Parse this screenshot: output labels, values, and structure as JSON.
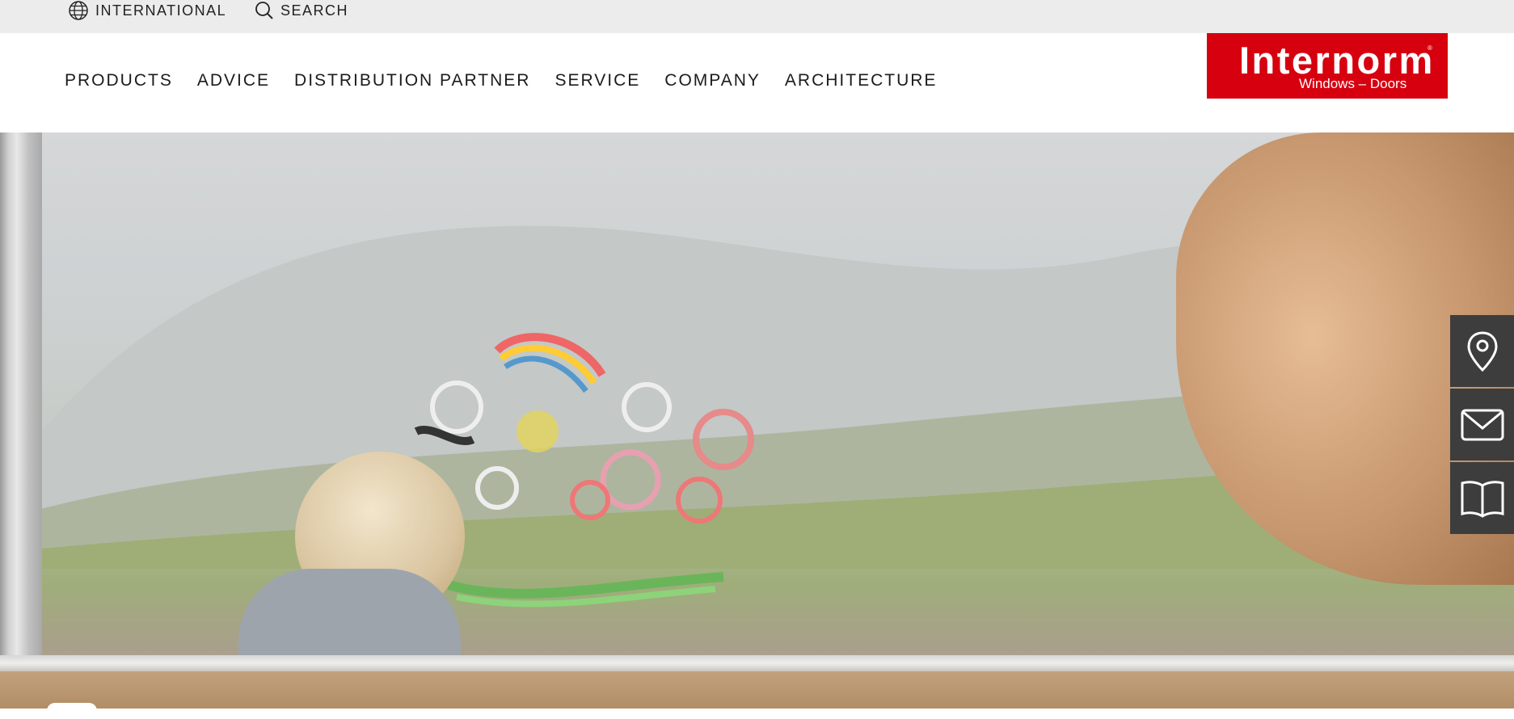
{
  "utility_bar": {
    "international_label": "INTERNATIONAL",
    "search_label": "SEARCH"
  },
  "nav": {
    "items": [
      {
        "label": "PRODUCTS"
      },
      {
        "label": "ADVICE"
      },
      {
        "label": "DISTRIBUTION PARTNER"
      },
      {
        "label": "SERVICE"
      },
      {
        "label": "COMPANY"
      },
      {
        "label": "ARCHITECTURE"
      }
    ]
  },
  "logo": {
    "wordmark": "Internorm",
    "tagline": "Windows – Doors",
    "brand_color": "#d6000f"
  },
  "side_actions": [
    {
      "icon": "location-pin-icon"
    },
    {
      "icon": "mail-icon"
    },
    {
      "icon": "catalog-book-icon"
    }
  ],
  "colors": {
    "utility_bar_bg": "#ececec",
    "side_button_bg": "#3d3d3d"
  }
}
